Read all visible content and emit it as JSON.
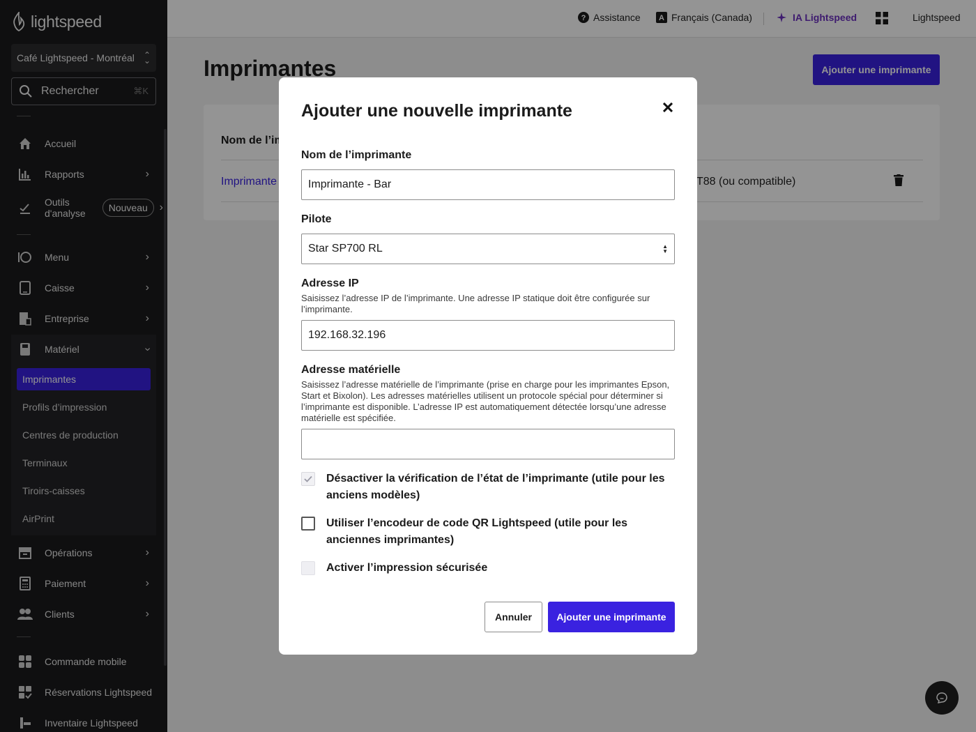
{
  "sidebar": {
    "logo": "lightspeed",
    "location": "Café Lightspeed - Montréal",
    "search": {
      "placeholder": "Rechercher",
      "shortcut": "⌘K"
    },
    "items": [
      {
        "label": "Accueil",
        "icon": "home-icon"
      },
      {
        "label": "Rapports",
        "icon": "chart-icon"
      },
      {
        "label": "Outils d’analyse",
        "icon": "analytics-icon",
        "badge": "Nouveau"
      },
      {
        "label": "Menu",
        "icon": "menu-icon"
      },
      {
        "label": "Caisse",
        "icon": "register-icon"
      },
      {
        "label": "Entreprise",
        "icon": "business-icon"
      },
      {
        "label": "Matériel",
        "icon": "hardware-icon"
      },
      {
        "label": "Opérations",
        "icon": "archive-icon"
      },
      {
        "label": "Paiement",
        "icon": "calculator-icon"
      },
      {
        "label": "Clients",
        "icon": "users-icon"
      },
      {
        "label": "Commande mobile",
        "icon": "grid-icon"
      },
      {
        "label": "Réservations Lightspeed",
        "icon": "reservations-icon"
      },
      {
        "label": "Inventaire Lightspeed",
        "icon": "inventory-icon"
      }
    ],
    "analytics_line1": "Outils",
    "analytics_line2": "d'analyse",
    "sub_items": [
      "Imprimantes",
      "Profils d’impression",
      "Centres de production",
      "Terminaux",
      "Tiroirs-caisses",
      "AirPrint"
    ]
  },
  "topbar": {
    "help": "Assistance",
    "language": "Français (Canada)",
    "ai": "IA Lightspeed",
    "account": "Lightspeed"
  },
  "main": {
    "title": "Imprimantes",
    "add_button": "Ajouter une imprimante",
    "table": {
      "header_name": "Nom de l’im",
      "row_name": "Imprimante",
      "row_driver": "T88 (ou compatible)"
    }
  },
  "modal": {
    "title": "Ajouter une nouvelle imprimante",
    "name_label": "Nom de l’imprimante",
    "name_value": "Imprimante - Bar",
    "driver_label": "Pilote",
    "driver_value": "Star SP700 RL",
    "ip_label": "Adresse IP",
    "ip_help": "Saisissez l’adresse IP de l’imprimante. Une adresse IP statique doit être configurée sur l’imprimante.",
    "ip_value": "192.168.32.196",
    "mac_label": "Adresse matérielle",
    "mac_help": "Saisissez l’adresse matérielle de l’imprimante (prise en charge pour les imprimantes Epson, Start et Bixolon). Les adresses matérielles utilisent un protocole spécial pour déterminer si l’imprimante est disponible. L’adresse IP est automatiquement détectée lorsqu’une adresse matérielle est spécifiée.",
    "mac_value": "",
    "check1": "Désactiver la vérification de l’état de l’imprimante (utile pour les anciens modèles)",
    "check2": "Utiliser l’encodeur de code QR Lightspeed (utile pour les anciennes imprimantes)",
    "check3": "Activer l’impression sécurisée",
    "cancel": "Annuler",
    "submit": "Ajouter une imprimante"
  },
  "colors": {
    "accent": "#3a22e0",
    "sidebar_bg": "#1b1b1d",
    "ai_purple": "#6b2fc0"
  }
}
